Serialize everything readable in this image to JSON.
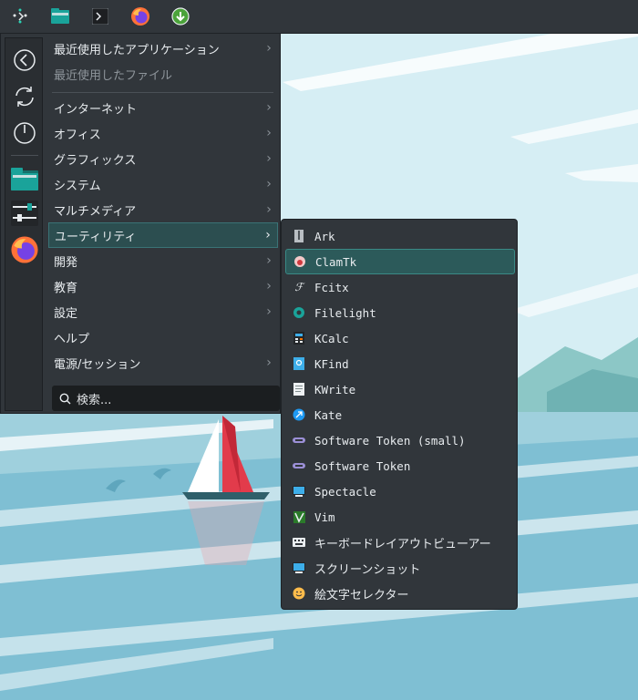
{
  "panel": {
    "items": [
      {
        "name": "application-launcher-icon"
      },
      {
        "name": "file-manager-icon"
      },
      {
        "name": "terminal-icon"
      },
      {
        "name": "firefox-icon"
      },
      {
        "name": "downloader-icon"
      }
    ]
  },
  "menu": {
    "recent_apps": "最近使用したアプリケーション",
    "recent_files": "最近使用したファイル",
    "categories": [
      {
        "label": "インターネット"
      },
      {
        "label": "オフィス"
      },
      {
        "label": "グラフィックス"
      },
      {
        "label": "システム"
      },
      {
        "label": "マルチメディア"
      },
      {
        "label": "ユーティリティ"
      },
      {
        "label": "開発"
      },
      {
        "label": "教育"
      },
      {
        "label": "設定"
      },
      {
        "label": "ヘルプ"
      },
      {
        "label": "電源/セッション"
      }
    ],
    "search_placeholder": "検索...",
    "favorites": [
      "back-icon",
      "refresh-icon",
      "power-icon",
      "folder-icon",
      "system-settings-icon",
      "firefox-icon"
    ]
  },
  "submenu": {
    "items": [
      {
        "label": "Ark",
        "icon": "archive-icon"
      },
      {
        "label": "ClamTk",
        "icon": "virus-scanner-icon"
      },
      {
        "label": "Fcitx",
        "icon": "input-method-icon"
      },
      {
        "label": "Filelight",
        "icon": "disk-usage-icon"
      },
      {
        "label": "KCalc",
        "icon": "calculator-icon"
      },
      {
        "label": "KFind",
        "icon": "find-icon"
      },
      {
        "label": "KWrite",
        "icon": "text-editor-icon"
      },
      {
        "label": "Kate",
        "icon": "kate-icon"
      },
      {
        "label": "Software Token (small)",
        "icon": "token-icon"
      },
      {
        "label": "Software Token",
        "icon": "token-icon"
      },
      {
        "label": "Spectacle",
        "icon": "screenshot-icon"
      },
      {
        "label": "Vim",
        "icon": "vim-icon"
      },
      {
        "label": "キーボードレイアウトビューアー",
        "icon": "keyboard-icon"
      },
      {
        "label": "スクリーンショット",
        "icon": "screenshot-icon"
      },
      {
        "label": "絵文字セレクター",
        "icon": "emoji-icon"
      }
    ]
  }
}
